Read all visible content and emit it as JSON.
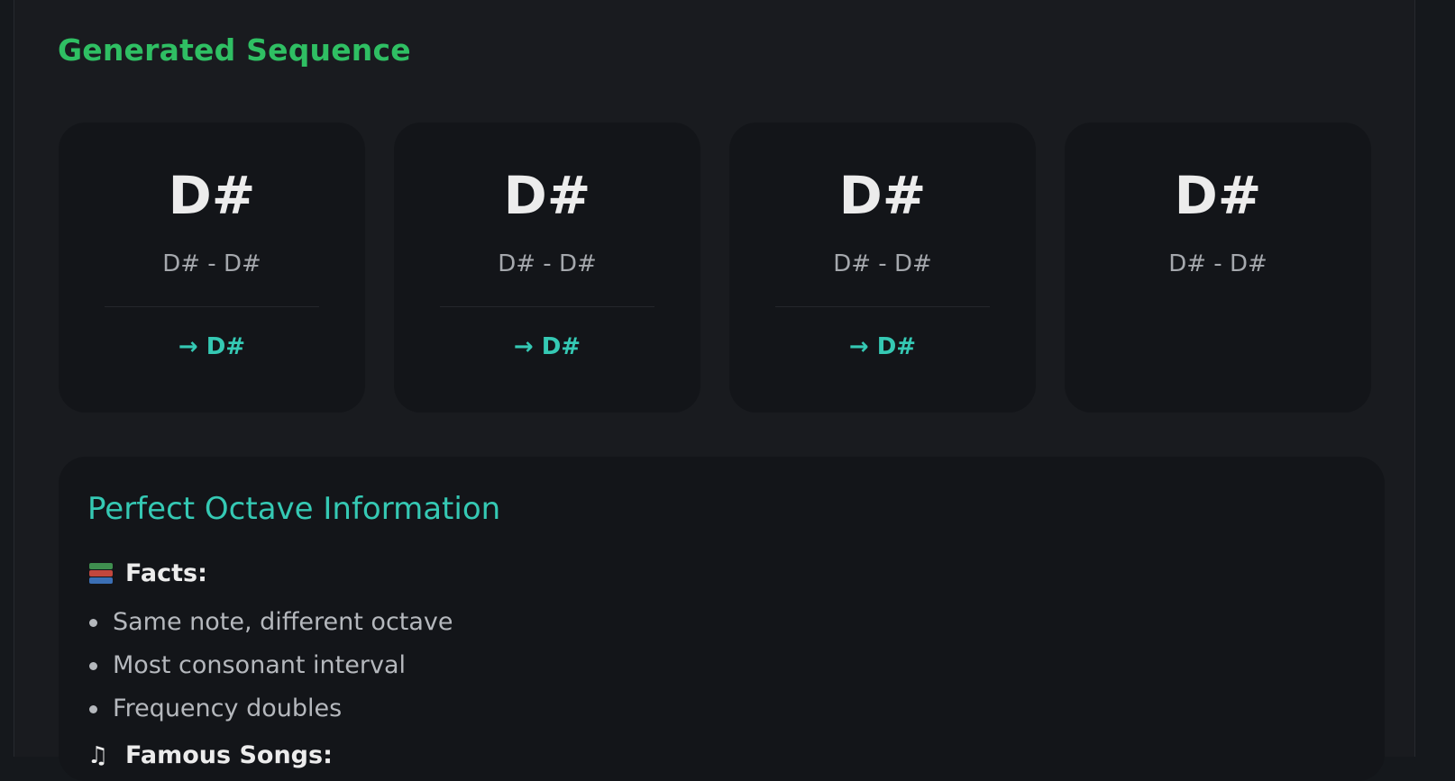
{
  "sequence": {
    "title": "Generated Sequence",
    "cards": [
      {
        "note": "D#",
        "range": "D# - D#",
        "next": "→ D#"
      },
      {
        "note": "D#",
        "range": "D# - D#",
        "next": "→ D#"
      },
      {
        "note": "D#",
        "range": "D# - D#",
        "next": "→ D#"
      },
      {
        "note": "D#",
        "range": "D# - D#",
        "next": ""
      }
    ]
  },
  "info": {
    "title": "Perfect Octave Information",
    "facts_icon": "books-icon",
    "facts_label": "Facts:",
    "facts": [
      "Same note, different octave",
      "Most consonant interval",
      "Frequency doubles"
    ],
    "songs_icon": "music-note-icon",
    "songs_label": "Famous Songs:"
  },
  "colors": {
    "accent_green": "#2fbf63",
    "accent_teal": "#35c9b4",
    "background": "#191b1f",
    "card_background": "#131519"
  }
}
